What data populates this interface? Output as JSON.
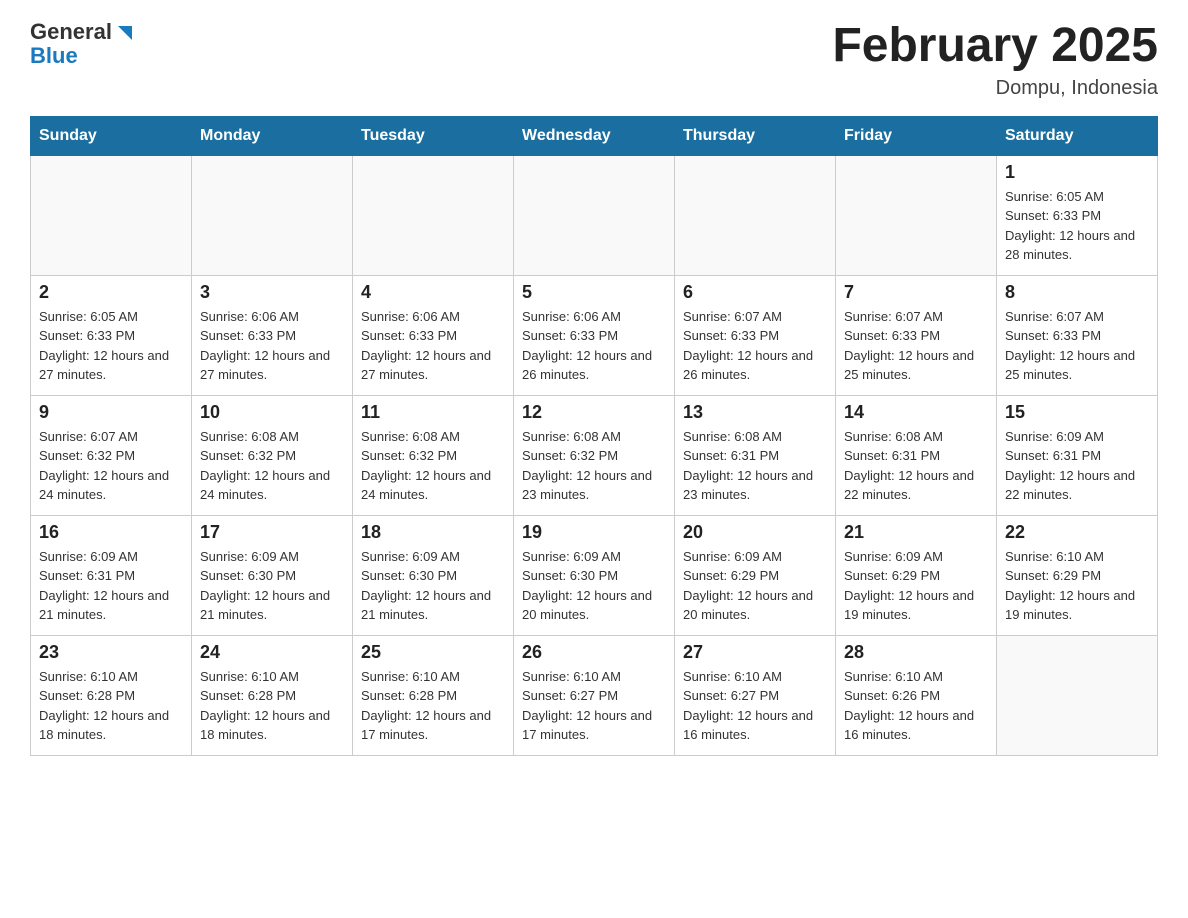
{
  "header": {
    "logo_general": "General",
    "logo_blue": "Blue",
    "month_title": "February 2025",
    "location": "Dompu, Indonesia"
  },
  "days_of_week": [
    "Sunday",
    "Monday",
    "Tuesday",
    "Wednesday",
    "Thursday",
    "Friday",
    "Saturday"
  ],
  "weeks": [
    [
      {
        "day": "",
        "sunrise": "",
        "sunset": "",
        "daylight": ""
      },
      {
        "day": "",
        "sunrise": "",
        "sunset": "",
        "daylight": ""
      },
      {
        "day": "",
        "sunrise": "",
        "sunset": "",
        "daylight": ""
      },
      {
        "day": "",
        "sunrise": "",
        "sunset": "",
        "daylight": ""
      },
      {
        "day": "",
        "sunrise": "",
        "sunset": "",
        "daylight": ""
      },
      {
        "day": "",
        "sunrise": "",
        "sunset": "",
        "daylight": ""
      },
      {
        "day": "1",
        "sunrise": "Sunrise: 6:05 AM",
        "sunset": "Sunset: 6:33 PM",
        "daylight": "Daylight: 12 hours and 28 minutes."
      }
    ],
    [
      {
        "day": "2",
        "sunrise": "Sunrise: 6:05 AM",
        "sunset": "Sunset: 6:33 PM",
        "daylight": "Daylight: 12 hours and 27 minutes."
      },
      {
        "day": "3",
        "sunrise": "Sunrise: 6:06 AM",
        "sunset": "Sunset: 6:33 PM",
        "daylight": "Daylight: 12 hours and 27 minutes."
      },
      {
        "day": "4",
        "sunrise": "Sunrise: 6:06 AM",
        "sunset": "Sunset: 6:33 PM",
        "daylight": "Daylight: 12 hours and 27 minutes."
      },
      {
        "day": "5",
        "sunrise": "Sunrise: 6:06 AM",
        "sunset": "Sunset: 6:33 PM",
        "daylight": "Daylight: 12 hours and 26 minutes."
      },
      {
        "day": "6",
        "sunrise": "Sunrise: 6:07 AM",
        "sunset": "Sunset: 6:33 PM",
        "daylight": "Daylight: 12 hours and 26 minutes."
      },
      {
        "day": "7",
        "sunrise": "Sunrise: 6:07 AM",
        "sunset": "Sunset: 6:33 PM",
        "daylight": "Daylight: 12 hours and 25 minutes."
      },
      {
        "day": "8",
        "sunrise": "Sunrise: 6:07 AM",
        "sunset": "Sunset: 6:33 PM",
        "daylight": "Daylight: 12 hours and 25 minutes."
      }
    ],
    [
      {
        "day": "9",
        "sunrise": "Sunrise: 6:07 AM",
        "sunset": "Sunset: 6:32 PM",
        "daylight": "Daylight: 12 hours and 24 minutes."
      },
      {
        "day": "10",
        "sunrise": "Sunrise: 6:08 AM",
        "sunset": "Sunset: 6:32 PM",
        "daylight": "Daylight: 12 hours and 24 minutes."
      },
      {
        "day": "11",
        "sunrise": "Sunrise: 6:08 AM",
        "sunset": "Sunset: 6:32 PM",
        "daylight": "Daylight: 12 hours and 24 minutes."
      },
      {
        "day": "12",
        "sunrise": "Sunrise: 6:08 AM",
        "sunset": "Sunset: 6:32 PM",
        "daylight": "Daylight: 12 hours and 23 minutes."
      },
      {
        "day": "13",
        "sunrise": "Sunrise: 6:08 AM",
        "sunset": "Sunset: 6:31 PM",
        "daylight": "Daylight: 12 hours and 23 minutes."
      },
      {
        "day": "14",
        "sunrise": "Sunrise: 6:08 AM",
        "sunset": "Sunset: 6:31 PM",
        "daylight": "Daylight: 12 hours and 22 minutes."
      },
      {
        "day": "15",
        "sunrise": "Sunrise: 6:09 AM",
        "sunset": "Sunset: 6:31 PM",
        "daylight": "Daylight: 12 hours and 22 minutes."
      }
    ],
    [
      {
        "day": "16",
        "sunrise": "Sunrise: 6:09 AM",
        "sunset": "Sunset: 6:31 PM",
        "daylight": "Daylight: 12 hours and 21 minutes."
      },
      {
        "day": "17",
        "sunrise": "Sunrise: 6:09 AM",
        "sunset": "Sunset: 6:30 PM",
        "daylight": "Daylight: 12 hours and 21 minutes."
      },
      {
        "day": "18",
        "sunrise": "Sunrise: 6:09 AM",
        "sunset": "Sunset: 6:30 PM",
        "daylight": "Daylight: 12 hours and 21 minutes."
      },
      {
        "day": "19",
        "sunrise": "Sunrise: 6:09 AM",
        "sunset": "Sunset: 6:30 PM",
        "daylight": "Daylight: 12 hours and 20 minutes."
      },
      {
        "day": "20",
        "sunrise": "Sunrise: 6:09 AM",
        "sunset": "Sunset: 6:29 PM",
        "daylight": "Daylight: 12 hours and 20 minutes."
      },
      {
        "day": "21",
        "sunrise": "Sunrise: 6:09 AM",
        "sunset": "Sunset: 6:29 PM",
        "daylight": "Daylight: 12 hours and 19 minutes."
      },
      {
        "day": "22",
        "sunrise": "Sunrise: 6:10 AM",
        "sunset": "Sunset: 6:29 PM",
        "daylight": "Daylight: 12 hours and 19 minutes."
      }
    ],
    [
      {
        "day": "23",
        "sunrise": "Sunrise: 6:10 AM",
        "sunset": "Sunset: 6:28 PM",
        "daylight": "Daylight: 12 hours and 18 minutes."
      },
      {
        "day": "24",
        "sunrise": "Sunrise: 6:10 AM",
        "sunset": "Sunset: 6:28 PM",
        "daylight": "Daylight: 12 hours and 18 minutes."
      },
      {
        "day": "25",
        "sunrise": "Sunrise: 6:10 AM",
        "sunset": "Sunset: 6:28 PM",
        "daylight": "Daylight: 12 hours and 17 minutes."
      },
      {
        "day": "26",
        "sunrise": "Sunrise: 6:10 AM",
        "sunset": "Sunset: 6:27 PM",
        "daylight": "Daylight: 12 hours and 17 minutes."
      },
      {
        "day": "27",
        "sunrise": "Sunrise: 6:10 AM",
        "sunset": "Sunset: 6:27 PM",
        "daylight": "Daylight: 12 hours and 16 minutes."
      },
      {
        "day": "28",
        "sunrise": "Sunrise: 6:10 AM",
        "sunset": "Sunset: 6:26 PM",
        "daylight": "Daylight: 12 hours and 16 minutes."
      },
      {
        "day": "",
        "sunrise": "",
        "sunset": "",
        "daylight": ""
      }
    ]
  ]
}
